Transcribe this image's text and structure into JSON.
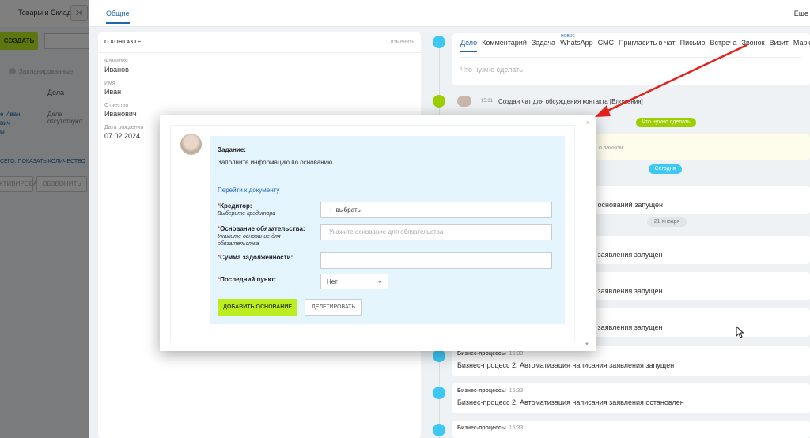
{
  "left": {
    "nav_title": "Товары и Склады",
    "mini_button": "⋊",
    "create_label": "СОЗДАТЬ",
    "scheduled_label": "Запланированные",
    "col_deals": "Дела",
    "name_line1": "е Иван",
    "name_line2": "вич",
    "name_line3": "ы",
    "deal_status": "Дела отсутствуют",
    "count_link": "СЕГО: ПОКАЗАТЬ КОЛИЧЕСТВО",
    "activate_label": "КТИВИРОВАТЬ",
    "call_label": "ОБЗВОНИТЬ"
  },
  "entity": {
    "tab_general": "Общие",
    "more": "Еще"
  },
  "contact": {
    "title": "О КОНТАКТЕ",
    "edit": "изменить",
    "fields": [
      {
        "label": "Фамилия",
        "value": "Иванов"
      },
      {
        "label": "Имя",
        "value": "Иван"
      },
      {
        "label": "Отчество",
        "value": "Иванович"
      },
      {
        "label": "Дата рождения",
        "value": "07.02.2024"
      }
    ]
  },
  "composer": {
    "tabs": [
      "Дело",
      "Комментарий",
      "Задача",
      "WhatsApp",
      "СМС",
      "Пригласить в чат",
      "Письмо",
      "Встреча",
      "Звонок",
      "Визит",
      "Маркет"
    ],
    "new_badge": "НОВОЕ",
    "placeholder": "Что нужно сделать"
  },
  "timeline": {
    "chat_time": "15:31",
    "chat_text": "Создан чат для обсуждения контакта [Вложения]",
    "todo_pill": "Что нужно сделать",
    "important_text": "о важном",
    "today_pill": "Сегодня",
    "bp1_partial": "а оснований запущен",
    "jan_pill": "21 января",
    "bp2_partial": "а заявления запущен",
    "bp3_partial": "а заявления запущен",
    "bp4_partial": "а заявления запущен",
    "items": [
      {
        "source": "Бизнес-процессы",
        "time": "15:33",
        "text": "Бизнес-процесс 2. Автоматизация написания заявления запущен"
      },
      {
        "source": "Бизнес-процессы",
        "time": "15:33",
        "text": "Бизнес-процесс 2. Автоматизация написания заявления остановлен"
      },
      {
        "source": "Бизнес-процессы",
        "time": "15:33",
        "text": ""
      }
    ]
  },
  "modal": {
    "close": "×",
    "scroll": "▼",
    "task_label": "Задание:",
    "task_text": "Заполните информацию по основанию",
    "doc_link": "Перейти к документу",
    "required_mark": "*",
    "creditor": {
      "name": "Кредитор:",
      "hint": "Выберите кредитора",
      "plus": "+",
      "action": "выбрать"
    },
    "basis": {
      "name": "Основание обязательства:",
      "hint": "Укажите основание для обязательства",
      "placeholder": "Укажите основание для обязательства"
    },
    "debt": {
      "name": "Сумма задолженности:"
    },
    "last_point": {
      "name": "Последний пункт:",
      "value": "Нет"
    },
    "add_button": "ДОБАВИТЬ ОСНОВАНИЕ",
    "delegate_button": "ДЕЛЕГИРОВАТЬ"
  },
  "colors": {
    "accent_green": "#bbed21",
    "link_blue": "#2067b0",
    "arrow_red": "#e3201b",
    "task_bg": "#e4f5fd"
  }
}
